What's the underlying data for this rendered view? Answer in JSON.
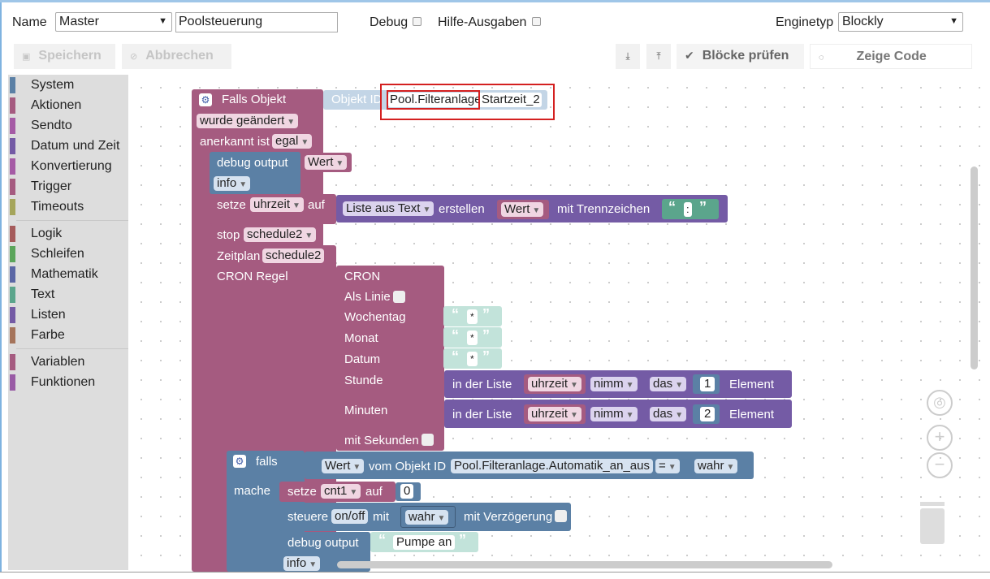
{
  "header": {
    "name_label": "Name",
    "name_select": "Master",
    "script_name": "Poolsteuerung",
    "debug_label": "Debug",
    "hilfe_label": "Hilfe-Ausgaben",
    "enginetyp_label": "Enginetyp",
    "enginetyp_value": "Blockly"
  },
  "toolbar": {
    "save_label": "Speichern",
    "cancel_label": "Abbrechen",
    "check_label": "Blöcke prüfen",
    "code_label": "Zeige Code"
  },
  "toolbox": {
    "items": [
      {
        "label": "System",
        "color": "#5b80a5"
      },
      {
        "label": "Aktionen",
        "color": "#a55b80"
      },
      {
        "label": "Sendto",
        "color": "#a55ba5"
      },
      {
        "label": "Datum und Zeit",
        "color": "#745ba5"
      },
      {
        "label": "Konvertierung",
        "color": "#a55ba5"
      },
      {
        "label": "Trigger",
        "color": "#a55b80"
      },
      {
        "label": "Timeouts",
        "color": "#a5a55b"
      },
      {
        "label": "Logik",
        "color": "#a55b5b"
      },
      {
        "label": "Schleifen",
        "color": "#5ba55b"
      },
      {
        "label": "Mathematik",
        "color": "#5b67a5"
      },
      {
        "label": "Text",
        "color": "#5ba58c"
      },
      {
        "label": "Listen",
        "color": "#745ba5"
      },
      {
        "label": "Farbe",
        "color": "#a5745b"
      },
      {
        "label": "Variablen",
        "color": "#a55b80"
      },
      {
        "label": "Funktionen",
        "color": "#995ba5"
      }
    ]
  },
  "blocks": {
    "trigger": {
      "title": "Falls Objekt",
      "object_id_label": "Objekt ID",
      "object_id_part1": "Pool.Filteranlage",
      "object_id_part2": "Startzeit_2",
      "changed": "wurde geändert",
      "ack_label": "anerkannt ist",
      "ack_value": "egal"
    },
    "debug1": {
      "label": "debug output",
      "value": "Wert",
      "level": "info"
    },
    "setze1": {
      "label": "setze",
      "var": "uhrzeit",
      "auf": "auf",
      "list_from_text": "Liste aus Text",
      "erstellen": "erstellen",
      "wert": "Wert",
      "trenn": "mit Trennzeichen",
      "sep": ":"
    },
    "stop": {
      "label": "stop",
      "value": "schedule2"
    },
    "zeitplan": {
      "label": "Zeitplan",
      "value": "schedule2",
      "cron_label": "CRON Regel"
    },
    "cron": {
      "title": "CRON",
      "als_linie": "Als Linie",
      "wochentag": "Wochentag",
      "monat": "Monat",
      "datum": "Datum",
      "stunde": "Stunde",
      "minuten": "Minuten",
      "sekunden": "mit Sekunden",
      "star": "*",
      "in_liste": "in der Liste",
      "var": "uhrzeit",
      "nimm": "nimm",
      "das": "das",
      "idx1": "1",
      "idx2": "2",
      "element": "Element"
    },
    "falls": {
      "label": "falls",
      "wert": "Wert",
      "vom_objekt": "vom Objekt ID",
      "object": "Pool.Filteranlage.Automatik_an_aus",
      "op": "=",
      "value": "wahr",
      "mache": "mache"
    },
    "setze2": {
      "label": "setze",
      "var": "cnt1",
      "auf": "auf",
      "value": "0"
    },
    "steuere": {
      "label": "steuere",
      "mode": "on/off",
      "mit": "mit",
      "value": "wahr",
      "delay": "mit Verzögerung"
    },
    "debug2": {
      "label": "debug output",
      "value": "Pumpe an",
      "level": "info"
    }
  },
  "icons": {
    "save": "floppy-icon",
    "cancel": "cancel-icon",
    "export": "export-icon",
    "import": "import-icon",
    "check": "check-icon",
    "code": "code-icon",
    "gear": "gear-icon",
    "center": "crosshair-icon",
    "zoom_in": "plus-icon",
    "zoom_out": "minus-icon",
    "trash": "trash-icon"
  }
}
